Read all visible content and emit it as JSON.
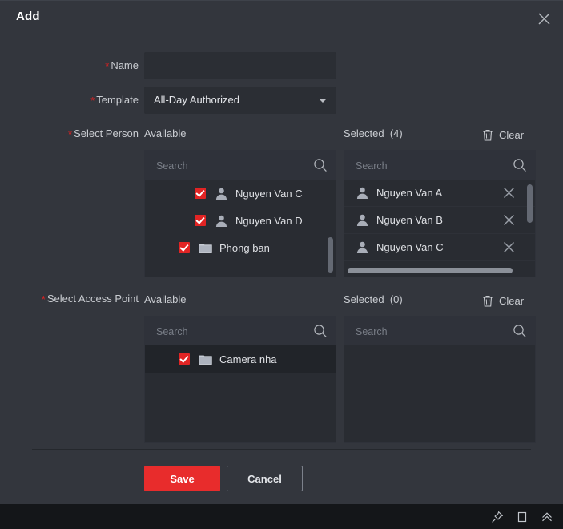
{
  "dialog": {
    "title": "Add",
    "close_icon": "close-icon"
  },
  "form": {
    "name": {
      "label": "Name",
      "required": true,
      "value": "",
      "placeholder": ""
    },
    "template": {
      "label": "Template",
      "required": true,
      "value": "All-Day Authorized",
      "caret_icon": "chevron-down-icon"
    }
  },
  "select_person": {
    "label": "Select Person",
    "required": true,
    "available": {
      "header": "Available",
      "search_placeholder": "Search",
      "search_value": "",
      "search_icon": "search-icon",
      "rows": [
        {
          "label": "Nguyen Van C",
          "icon": "person-icon",
          "checked": true,
          "depth": 1,
          "highlighted": false
        },
        {
          "label": "Nguyen Van D",
          "icon": "person-icon",
          "checked": true,
          "depth": 1,
          "highlighted": false
        },
        {
          "label": "Phong ban",
          "icon": "folder-icon",
          "checked": true,
          "depth": 0,
          "highlighted": false
        }
      ]
    },
    "selected": {
      "header": "Selected",
      "count": "(4)",
      "clear_label": "Clear",
      "clear_icon": "trash-icon",
      "search_placeholder": "Search",
      "search_value": "",
      "search_icon": "search-icon",
      "rows": [
        {
          "label": "Nguyen Van A",
          "icon": "person-icon",
          "remove_icon": "close-icon"
        },
        {
          "label": "Nguyen Van B",
          "icon": "person-icon",
          "remove_icon": "close-icon"
        },
        {
          "label": "Nguyen Van C",
          "icon": "person-icon",
          "remove_icon": "close-icon"
        }
      ]
    }
  },
  "select_access_point": {
    "label": "Select Access Point",
    "required": true,
    "available": {
      "header": "Available",
      "search_placeholder": "Search",
      "search_value": "",
      "search_icon": "search-icon",
      "rows": [
        {
          "label": "Camera nha",
          "icon": "folder-icon",
          "checked": true,
          "depth": 0,
          "highlighted": true
        }
      ]
    },
    "selected": {
      "header": "Selected",
      "count": "(0)",
      "clear_label": "Clear",
      "clear_icon": "trash-icon",
      "search_placeholder": "Search",
      "search_value": "",
      "search_icon": "search-icon",
      "rows": []
    }
  },
  "footer": {
    "save_label": "Save",
    "cancel_label": "Cancel"
  },
  "taskbar": {
    "icons": [
      "pin-icon",
      "maximize-icon",
      "chevron-double-up-icon"
    ]
  },
  "colors": {
    "accent_red": "#e82c2c",
    "checkbox_red": "#e12424",
    "required_star": "#e02020",
    "dialog_bg": "#33363d",
    "panel_bg": "#292c32",
    "input_bg": "#2b2e34",
    "taskbar_bg": "#141619",
    "text": "#d6d8dc"
  }
}
